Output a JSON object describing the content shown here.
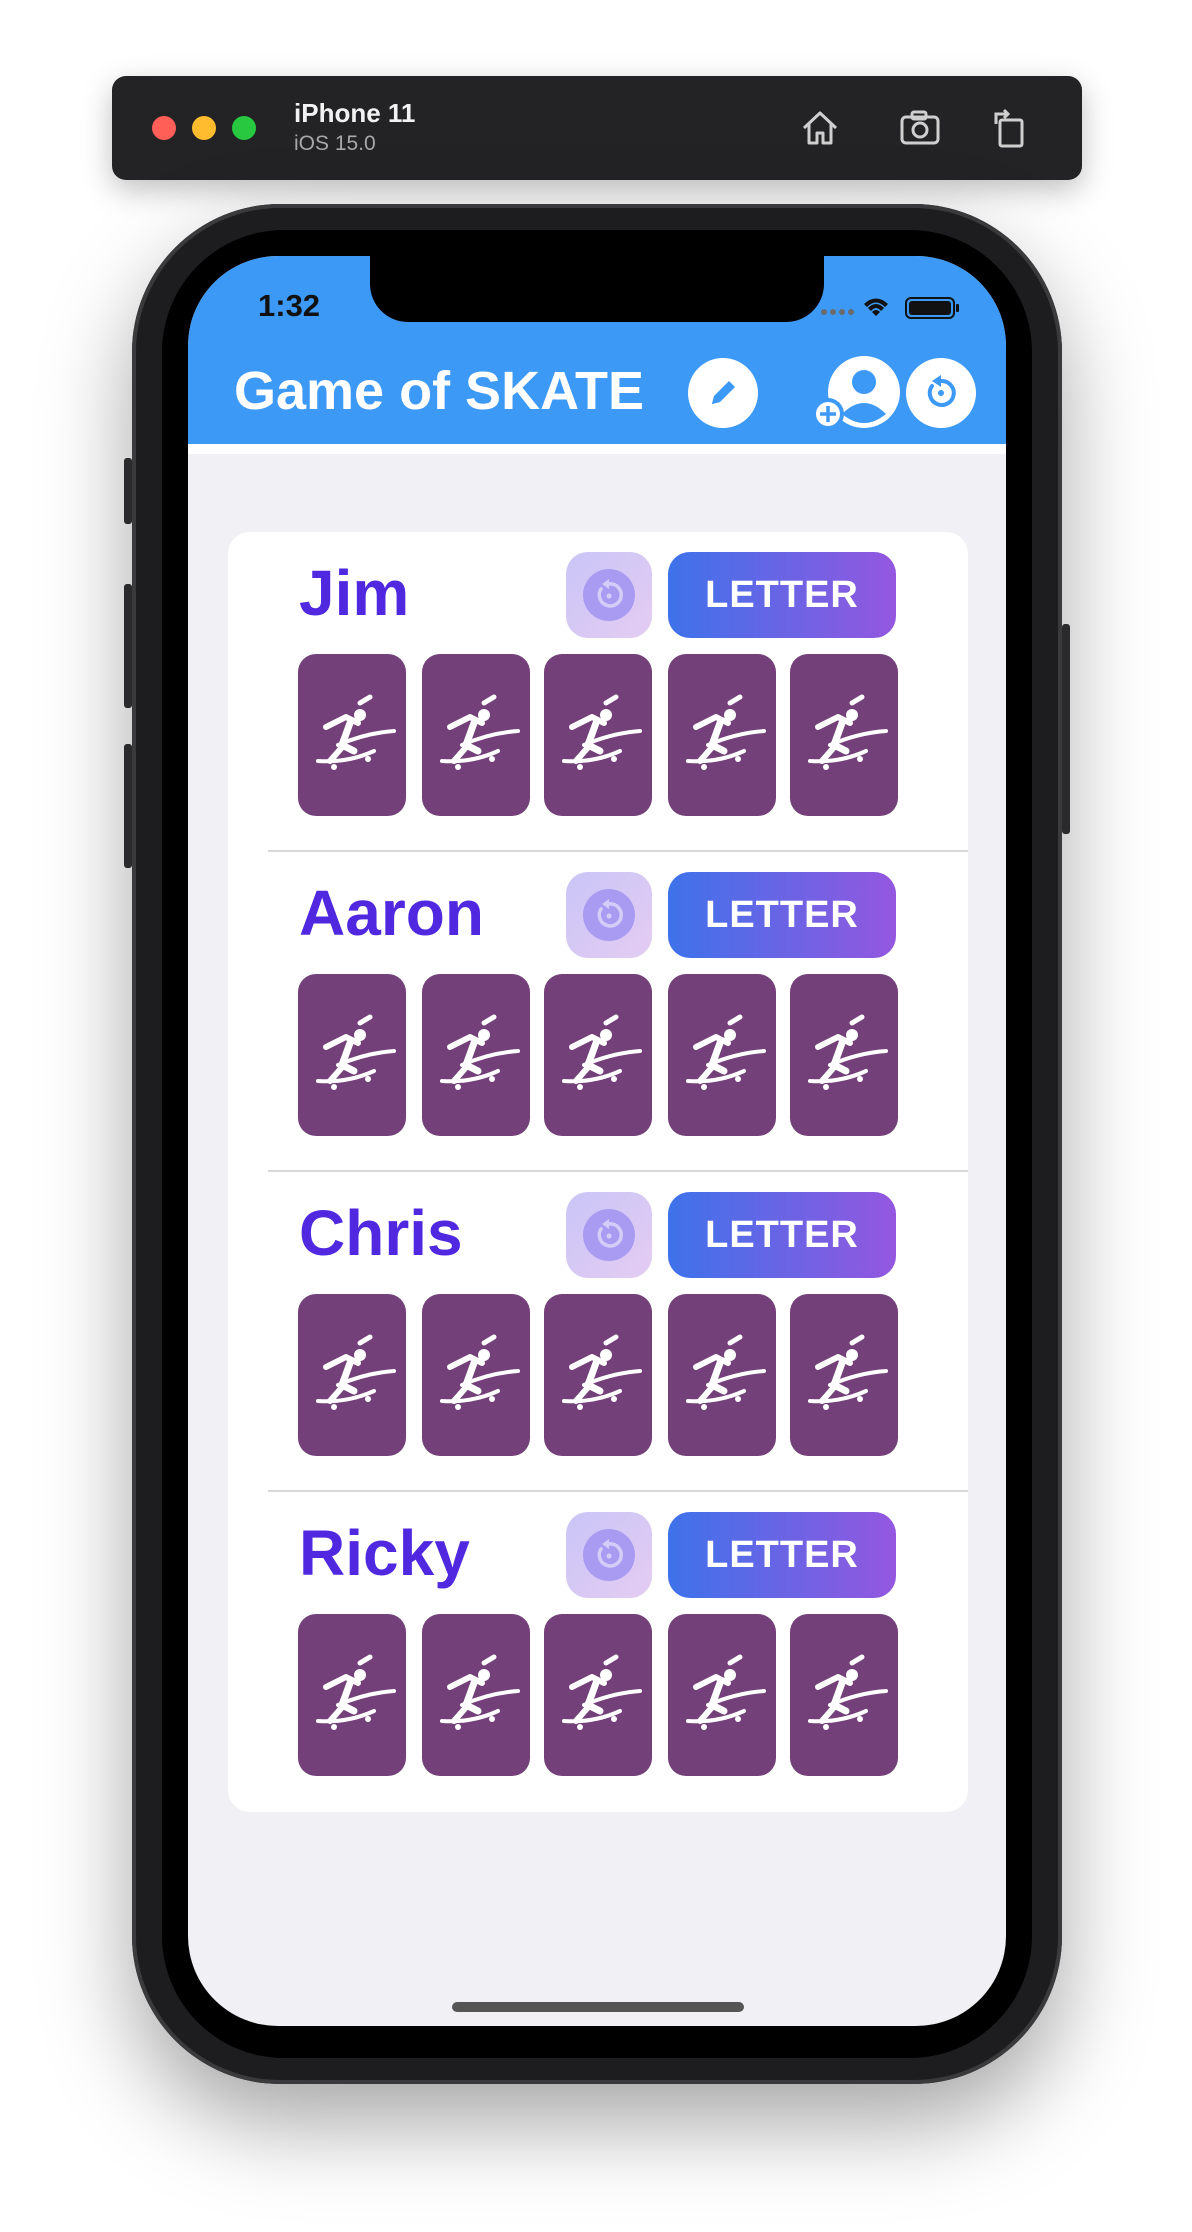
{
  "simulator": {
    "device_name": "iPhone 11",
    "os_version": "iOS 15.0",
    "toolbar_icons": [
      "home-icon",
      "screenshot-icon",
      "rotate-icon"
    ]
  },
  "status_bar": {
    "time": "1:32",
    "icons": [
      "signal-icon",
      "wifi-icon",
      "battery-icon"
    ]
  },
  "header": {
    "title": "Game of SKATE",
    "buttons": [
      "edit-pencil-icon",
      "add-player-icon",
      "reset-game-icon"
    ],
    "background_color": "#3c99f6"
  },
  "players": [
    {
      "name": "Jim",
      "undo_icon": "undo-icon",
      "letter_button": "LETTER",
      "tiles": [
        "skater-icon",
        "skater-icon",
        "skater-icon",
        "skater-icon",
        "skater-icon"
      ]
    },
    {
      "name": "Aaron",
      "undo_icon": "undo-icon",
      "letter_button": "LETTER",
      "tiles": [
        "skater-icon",
        "skater-icon",
        "skater-icon",
        "skater-icon",
        "skater-icon"
      ]
    },
    {
      "name": "Chris",
      "undo_icon": "undo-icon",
      "letter_button": "LETTER",
      "tiles": [
        "skater-icon",
        "skater-icon",
        "skater-icon",
        "skater-icon",
        "skater-icon"
      ]
    },
    {
      "name": "Ricky",
      "undo_icon": "undo-icon",
      "letter_button": "LETTER",
      "tiles": [
        "skater-icon",
        "skater-icon",
        "skater-icon",
        "skater-icon",
        "skater-icon"
      ]
    }
  ],
  "colors": {
    "player_name": "#4f28e0",
    "tile": "#74407a",
    "letter_gradient_start": "#3e72ea",
    "letter_gradient_end": "#9457df"
  }
}
